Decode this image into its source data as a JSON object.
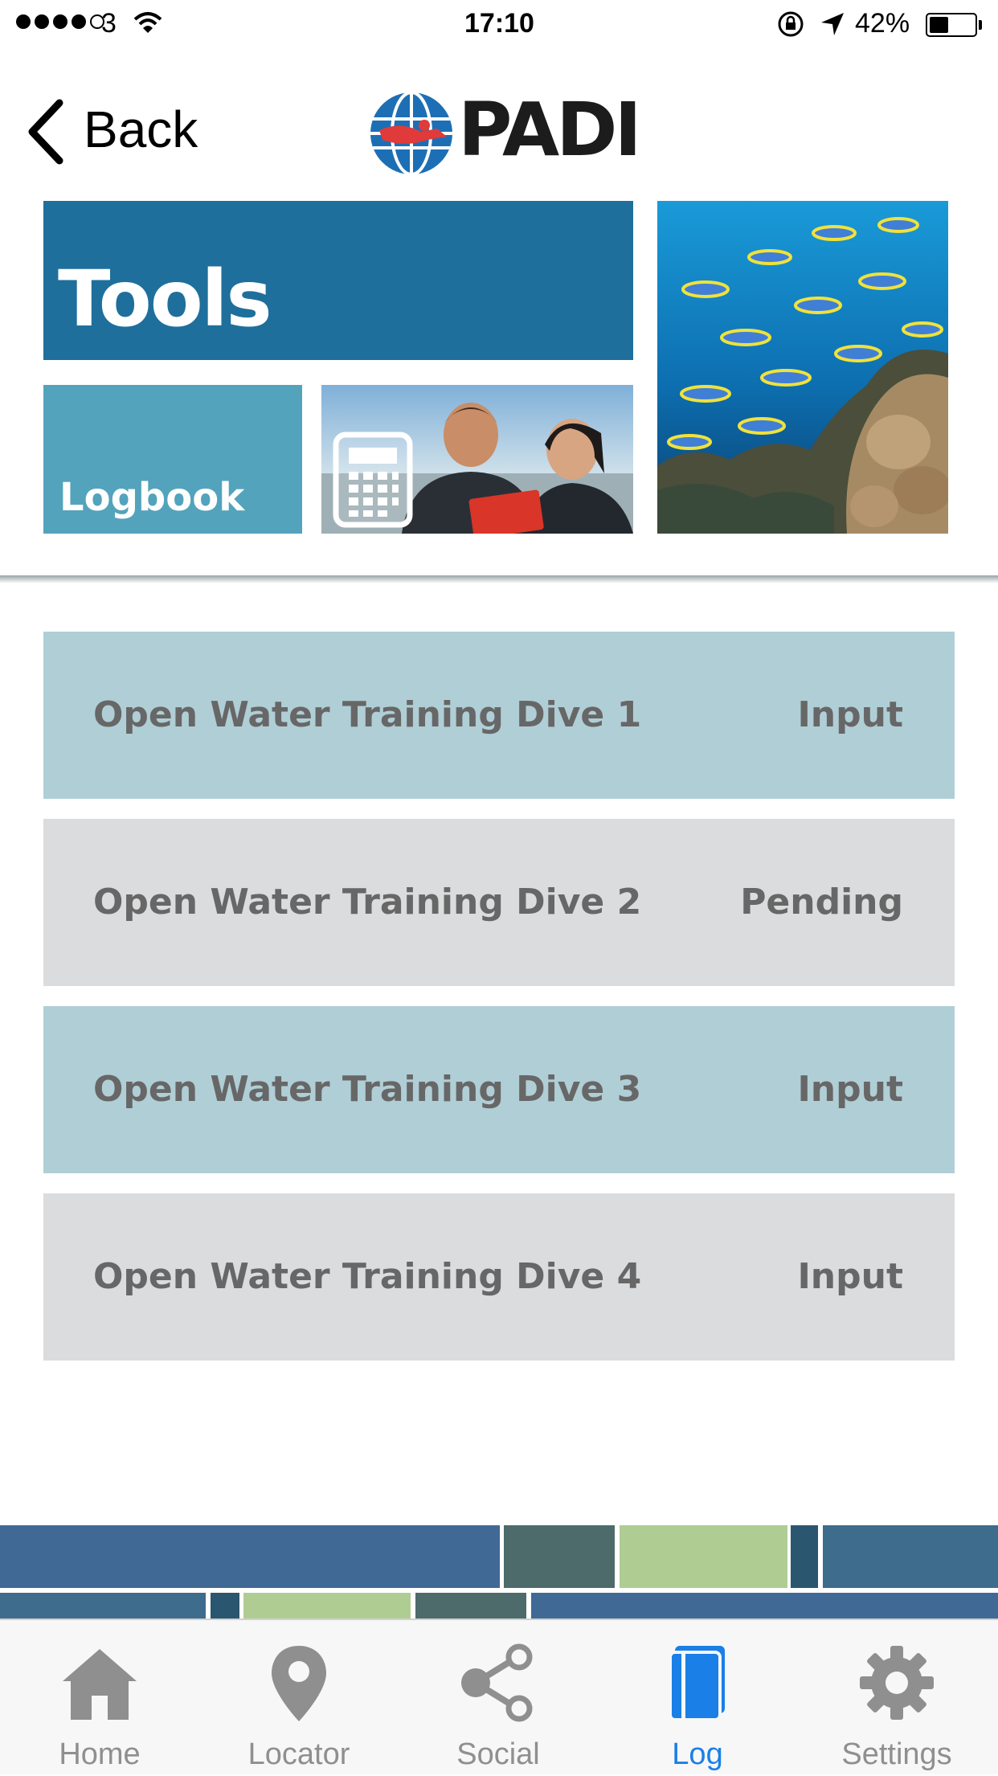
{
  "status_bar": {
    "carrier": "3",
    "time": "17:10",
    "battery_percent": "42%",
    "battery_level": 0.42,
    "signal_bars": 4
  },
  "nav": {
    "back_label": "Back",
    "logo_text": "PADI"
  },
  "tiles": {
    "tools_label": "Tools",
    "logbook_label": "Logbook"
  },
  "dives": [
    {
      "title": "Open Water Training Dive 1",
      "status": "Input"
    },
    {
      "title": "Open Water Training Dive 2",
      "status": "Pending"
    },
    {
      "title": "Open Water Training Dive 3",
      "status": "Input"
    },
    {
      "title": "Open Water Training Dive 4",
      "status": "Input"
    }
  ],
  "tabbar": {
    "items": [
      {
        "label": "Home",
        "icon": "home-icon",
        "active": false
      },
      {
        "label": "Locator",
        "icon": "location-pin-icon",
        "active": false
      },
      {
        "label": "Social",
        "icon": "share-icon",
        "active": false
      },
      {
        "label": "Log",
        "icon": "book-icon",
        "active": true
      },
      {
        "label": "Settings",
        "icon": "gear-icon",
        "active": false
      }
    ]
  },
  "colors": {
    "tools_tile": "#1e6f9c",
    "logbook_tile": "#53a3bc",
    "row_blue": "#b0ced6",
    "row_gray": "#dadcde",
    "tab_active": "#1a7fe6",
    "tab_inactive": "#8f8f8f"
  }
}
